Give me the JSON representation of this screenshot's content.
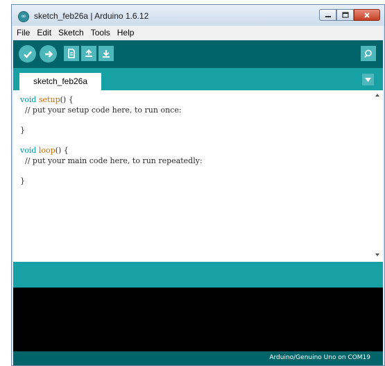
{
  "window": {
    "title": "sketch_feb26a | Arduino 1.6.12",
    "app_icon": "arduino-infinity-icon",
    "controls": {
      "minimize": "minimize-icon",
      "maximize": "maximize-icon",
      "close": "close-icon"
    }
  },
  "menu": [
    "File",
    "Edit",
    "Sketch",
    "Tools",
    "Help"
  ],
  "toolbar": {
    "buttons": [
      {
        "name": "verify",
        "icon": "checkmark-icon"
      },
      {
        "name": "upload",
        "icon": "right-arrow-icon"
      },
      {
        "name": "new",
        "icon": "new-file-icon"
      },
      {
        "name": "open",
        "icon": "up-arrow-icon"
      },
      {
        "name": "save",
        "icon": "down-arrow-icon"
      }
    ],
    "serial_monitor_icon": "magnifier-icon"
  },
  "tabs": {
    "active": "sketch_feb26a",
    "menu_icon": "down-triangle-icon"
  },
  "editor": {
    "setup_sig": "void setup() {",
    "setup_comment": "  // put your setup code here, to run once:",
    "setup_close": "}",
    "loop_sig": "void loop() {",
    "loop_comment": "  // put your main code here, to run repeatedly:",
    "loop_close": "}"
  },
  "status": {
    "board": "Arduino/Genuino Uno on COM19"
  },
  "colors": {
    "toolbar": "#006468",
    "tabstrip": "#17a1a5",
    "button": "#4db7bb",
    "keyword": "#00979c",
    "function": "#cc6600",
    "console": "#000000"
  }
}
